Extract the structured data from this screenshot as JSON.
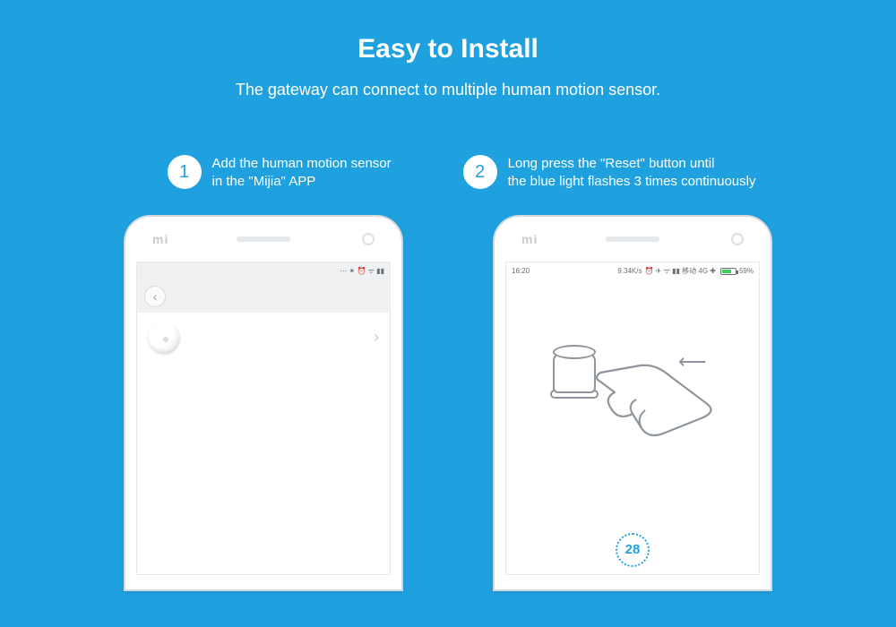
{
  "header": {
    "title": "Easy to Install",
    "subtitle": "The gateway can connect to multiple human motion sensor."
  },
  "steps": [
    {
      "num": "1",
      "line1": "Add the human motion sensor",
      "line2": "in the \"Mijia\" APP"
    },
    {
      "num": "2",
      "line1": "Long press the \"Reset\" button until",
      "line2": "the blue light flashes 3 times continuously"
    }
  ],
  "phone_logo": "mi",
  "phone1": {
    "status_icons": "⋯ ⁕ ⏰ ᯤ ▮▮"
  },
  "phone2": {
    "time": "16:20",
    "net_speed": "9.34K/s",
    "status_extra": "⏰ ✈ ᯤ ▮▮ 移动 4G ✚",
    "battery_pct": "59%",
    "countdown": "28"
  }
}
